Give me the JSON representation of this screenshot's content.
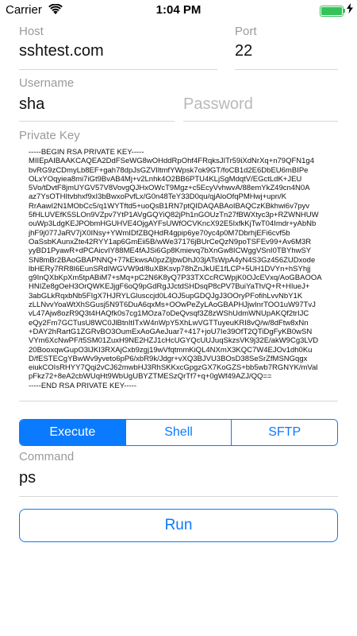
{
  "status_bar": {
    "carrier": "Carrier",
    "time": "1:04 PM",
    "battery_level": 1.0,
    "battery_color": "#35c25a"
  },
  "form": {
    "host": {
      "label": "Host",
      "value": "sshtest.com"
    },
    "port": {
      "label": "Port",
      "value": "22"
    },
    "username": {
      "label": "Username",
      "value": "sha"
    },
    "password": {
      "placeholder": "Password"
    },
    "private_key": {
      "label": "Private Key",
      "lines": [
        "-----BEGIN RSA PRIVATE KEY-----",
        "MIIEpAIBAAKCAQEA2DdFSeWG8wOHddRpOhf4FRqksJITr59iXdNrXq+n79QFN1g4",
        "bvRG9zCDmyLb8EF+gah78dpJsGZVIltmfYWpsk7ok9GT/foCB1d2E6DbEU6mBIPe",
        "OLxYOqyiea8mi7iGt9BvAB4Mj+v2Lnhk4O2BB6PTU4KLjSgMdqtV/EGctLdK+JEU",
        "5Vo/tDvtF8jmUYGV57V8VovgQJHxOWcT9Mgz+c5EcyVvhwvA/88emYkZ49cn4N0A",
        "az7YsOTHItvbhxf9xI3bBwxoPvfLx/G0n48TeY33D0qu/qjAloOfqPMHwj+upn/K",
        "RrAawI2N1MObCc5/q1WYTftd5+uoQsB1RN7ptQIDAQABAoIBAQCzKBkhwi6v7pyv",
        "5fHLUVEfK5SLOn9VZpv7YtP1AVgGQYiQ82jPh1nGOUzTn27fBWXtyc3p+RZWNHUW",
        "ouWp3LdgKEJPObmHGUHVE4OjgAYFsUWfOCVKncX92E5IxfkKjTwT04Imdr+yAbNb",
        "jhF9j077JaRV7jX0INsy+YWmIDfZBQHdR4gpip6ye70yc4p0M7DbrhjEFi6cvf5b",
        "OaSsbKAunxZte42RYY1ap6GmEii5B/wWe37176jBUrCeQzN9poTSFEv99+Av6M3R",
        "yyBD1PyawR+dPCAicvIY88ME4fAJSi6Gp8Kmievq7bXnGw8ICWggVSnI0TBYhwSY",
        "SN8mBr2BAoGBAPNNQ+77kEkwsA0pzZljbwDhJ03jATsWpA4yN4S3Gz456ZUDxode",
        "lbHERy7RR8I6EunSRdIWGVW9d/8uXBKsvp78hZnJkUE1fLCP+5UH1DVYn+hSYhjj",
        "g9InQXbKpXm5tpABiM7+sMq+pC2N6K8yQ7P33TXCcRCWpjK0OJcEVxq/AoGBAOOA",
        "HNIZe8gOeH3OrQWKEJjgF6oQ9pGdRgJJctdSHDsqP8cPV7BuiYaTh/Q+R+HIueJ+",
        "3abGLkRqxbNb5FIgX7HJRYLGlusccjd0L4OJ5upGDQJgJ3OOryPFofihLvvNbY1K",
        "zLLNvvYoaWtXhSGusj5N9T6DuA6qxMs+OOwPeZyLAoGBAPHJjwInrTOO1uW97TvJ",
        "vL47Ajw8ozR9Q3t4HAQfk0s7cg1MOza7oDeQvsqf3Z8zWShUdmWNUpAKQf2trIJC",
        "eQy2Fm7GCTusU8WC0JlBtnItITxW4nWpY5XhLwVGTTuyeuKRI8vQ/w/8dFtw8xNn",
        "+DAY2hRartG1ZGRvBO3OumExAoGAeJuar7+417+joU7Ie39OfT2QTiDgFyKB0wSN",
        "VYm6XcNwPF/t5SM01ZuxH9NE2HZJ1cHcUGYQcUUJuqSkzsVK9j32E/akW9Cg3LVD",
        "20BooxqwGupO3lJKI3RXAjCxb9zgj19wVfqtmmKiQL4NXmX3KQC7W4EJOv1dh0Ku",
        "D/fESTECgYBwWv9yveto6pP6/xbR9k/Jdgr+vXQ3BJVU3BOsD38SeSrZfMSNGqgx",
        "eiukCOIsRHYY7Qqi2vCJ62mwbHJ3RhSKKxcGpgzGX7KoGZS+bb5wb7RGNYK/mVal",
        "pFkz72+8eA2cbWUqHt9WbUgUBYZTMESzQrTf7+q+0gWf49AZJ/QQ==",
        "-----END RSA PRIVATE KEY-----"
      ]
    }
  },
  "mode_selector": {
    "options": [
      "Execute",
      "Shell",
      "SFTP"
    ],
    "selected": "Execute"
  },
  "command": {
    "label": "Command",
    "value": "ps"
  },
  "actions": {
    "run_label": "Run"
  },
  "colors": {
    "accent": "#0a7aff",
    "label": "#9a9a9a",
    "placeholder": "#b9b9bd",
    "divider": "#d7d7d7"
  }
}
